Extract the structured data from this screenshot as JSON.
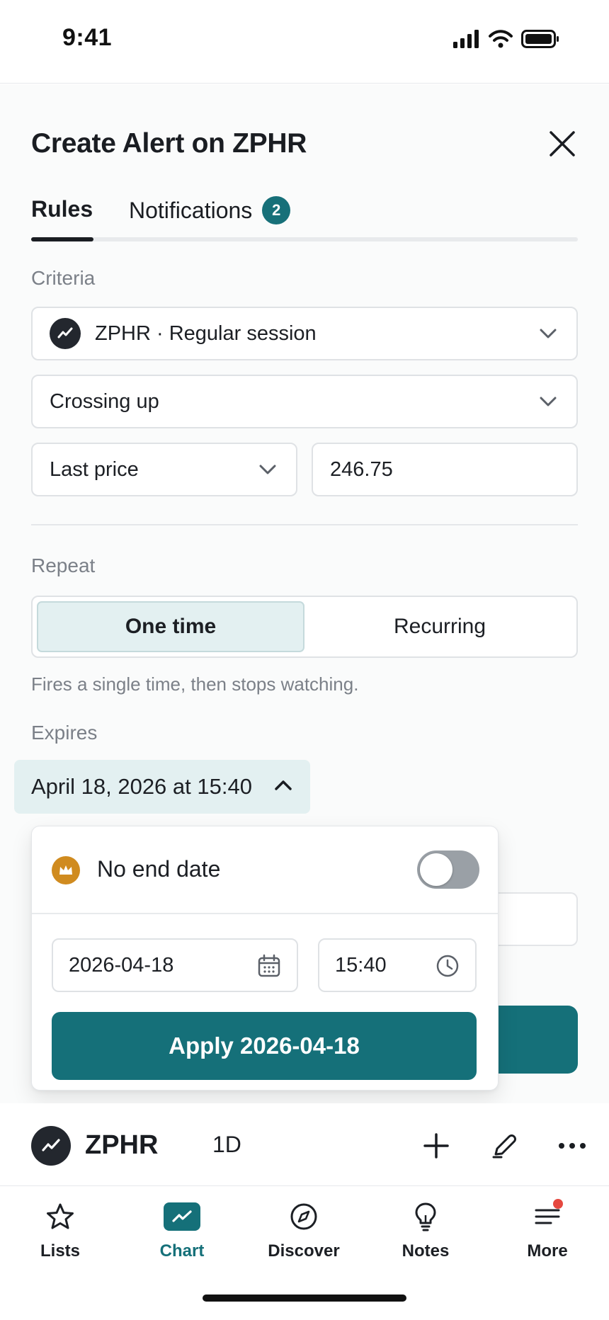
{
  "status_bar": {
    "time": "9:41"
  },
  "sheet": {
    "title": "Create Alert on ZPHR",
    "tabs": [
      {
        "label": "Rules",
        "active": true
      },
      {
        "label": "Notifications",
        "badge": "2"
      }
    ]
  },
  "criteria": {
    "section_label": "Criteria",
    "symbol_select": "ZPHR · Regular session",
    "condition_select": "Crossing up",
    "source_select": "Last price",
    "value_input": "246.75"
  },
  "repeat": {
    "section_label": "Repeat",
    "options": [
      "One time",
      "Recurring"
    ],
    "selected": "One time",
    "hint": "Fires a single time, then stops watching."
  },
  "expires": {
    "section_label": "Expires",
    "chip_label": "April 18, 2026 at 15:40"
  },
  "popover": {
    "no_end_label": "No end date",
    "no_end_enabled": false,
    "date_value": "2026-04-18",
    "time_value": "15:40",
    "apply_label": "Apply 2026-04-18"
  },
  "ticker_bar": {
    "symbol": "ZPHR",
    "interval": "1D"
  },
  "bottom_nav": {
    "items": [
      {
        "label": "Lists",
        "icon": "star-icon"
      },
      {
        "label": "Chart",
        "icon": "chart-icon",
        "active": true
      },
      {
        "label": "Discover",
        "icon": "compass-icon"
      },
      {
        "label": "Notes",
        "icon": "lightbulb-icon"
      },
      {
        "label": "More",
        "icon": "menu-icon"
      }
    ]
  },
  "colors": {
    "accent": "#157079",
    "badge": "#177079",
    "chip_bg": "#e3f0f1",
    "crown": "#d08b1f",
    "notify_dot": "#e5483f"
  }
}
